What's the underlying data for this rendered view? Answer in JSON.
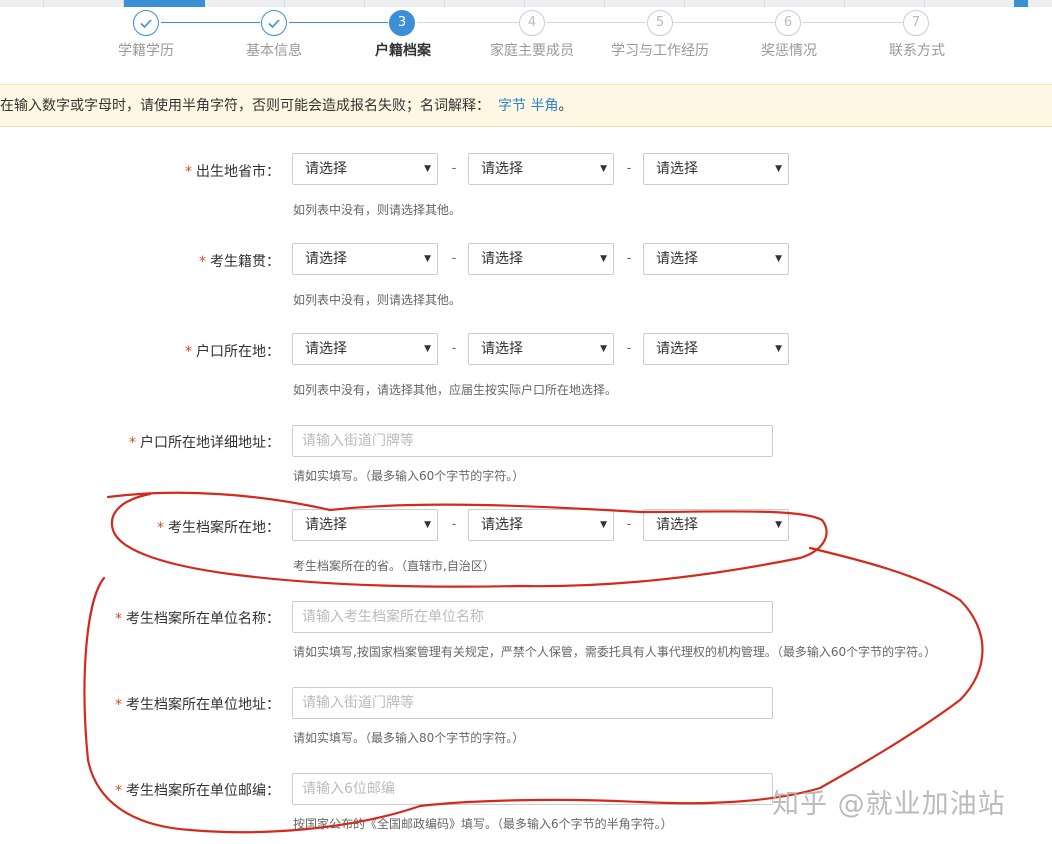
{
  "steps": [
    {
      "number": "1",
      "label": "学籍学历",
      "state": "done",
      "icon": "check-icon"
    },
    {
      "number": "2",
      "label": "基本信息",
      "state": "done",
      "icon": "check-icon"
    },
    {
      "number": "3",
      "label": "户籍档案",
      "state": "current"
    },
    {
      "number": "4",
      "label": "家庭主要成员",
      "state": "todo"
    },
    {
      "number": "5",
      "label": "学习与工作经历",
      "state": "todo"
    },
    {
      "number": "6",
      "label": "奖惩情况",
      "state": "todo"
    },
    {
      "number": "7",
      "label": "联系方式",
      "state": "todo"
    }
  ],
  "notice": {
    "text": "在输入数字或字母时，请使用半角字符，否则可能会造成报名失败；名词解释：",
    "terms": "字节 半角",
    "end": "。"
  },
  "form": {
    "birthplace": {
      "label": "出生地省市：",
      "selects": [
        "请选择",
        "请选择",
        "请选择"
      ],
      "hint": "如列表中没有，则请选择其他。"
    },
    "native_place": {
      "label": "考生籍贯：",
      "selects": [
        "请选择",
        "请选择",
        "请选择"
      ],
      "hint": "如列表中没有，则请选择其他。"
    },
    "hukou": {
      "label": "户口所在地：",
      "selects": [
        "请选择",
        "请选择",
        "请选择"
      ],
      "hint": "如列表中没有，请选择其他，应届生按实际户口所在地选择。"
    },
    "hukou_address": {
      "label": "户口所在地详细地址：",
      "placeholder": "请输入街道门牌等",
      "hint": "请如实填写。（最多输入60个字节的字符。）"
    },
    "archive_location": {
      "label": "考生档案所在地：",
      "selects": [
        "请选择",
        "请选择",
        "请选择"
      ],
      "hint": "考生档案所在的省。（直辖市,自治区）"
    },
    "archive_unit_name": {
      "label": "考生档案所在单位名称：",
      "placeholder": "请输入考生档案所在单位名称",
      "hint": "请如实填写,按国家档案管理有关规定，严禁个人保管，需委托具有人事代理权的机构管理。（最多输入60个字节的字符。）"
    },
    "archive_unit_address": {
      "label": "考生档案所在单位地址：",
      "placeholder": "请输入街道门牌等",
      "hint": "请如实填写。（最多输入80个字节的字符。）"
    },
    "archive_unit_postcode": {
      "label": "考生档案所在单位邮编：",
      "placeholder": "请输入6位邮编",
      "hint": "按国家公布的《全国邮政编码》填写。（最多输入6个字节的半角字符。）"
    }
  },
  "watermark": "知乎 @就业加油站",
  "colors": {
    "accent": "#3a8fd6",
    "required": "#e04a22",
    "annotation": "#d42a1e",
    "notice_bg": "#fdf7e3"
  }
}
